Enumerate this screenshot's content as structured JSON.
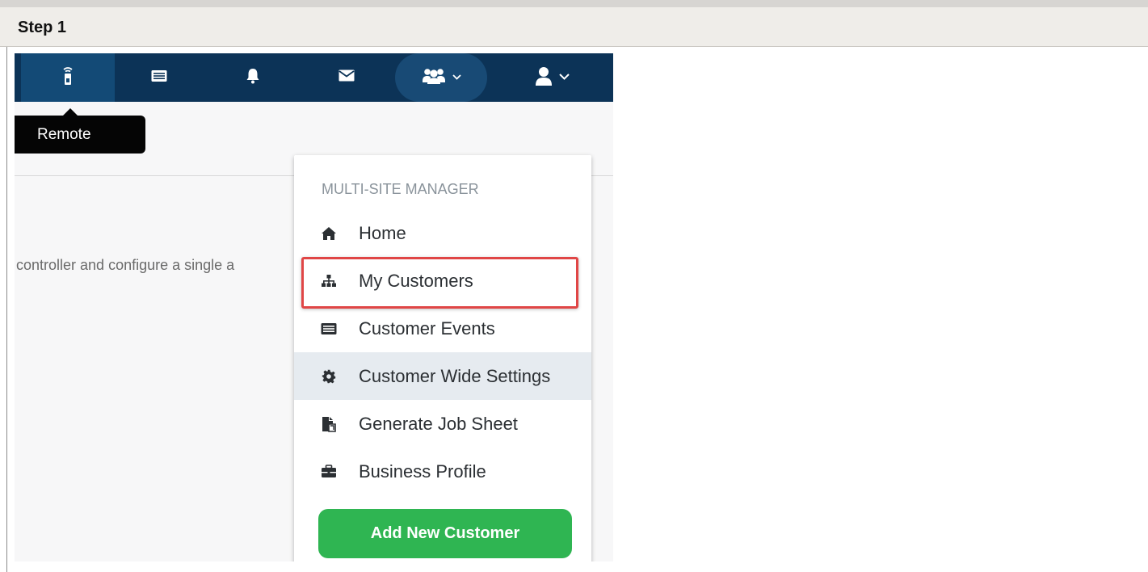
{
  "step": {
    "title": "Step 1"
  },
  "navbar": {
    "items": [
      {
        "name": "remote",
        "icon": "remote-icon"
      },
      {
        "name": "events",
        "icon": "list-icon"
      },
      {
        "name": "alerts",
        "icon": "bell-icon"
      },
      {
        "name": "mail",
        "icon": "envelope-icon"
      },
      {
        "name": "multi-site",
        "icon": "group-icon"
      },
      {
        "name": "user",
        "icon": "user-icon"
      }
    ]
  },
  "tooltip": {
    "label": "Remote"
  },
  "background": {
    "text": "controller and configure a single a"
  },
  "dropdown": {
    "header": "MULTI-SITE MANAGER",
    "items": [
      {
        "label": "Home",
        "icon": "home-icon"
      },
      {
        "label": "My Customers",
        "icon": "sitemap-icon",
        "highlighted": true
      },
      {
        "label": "Customer Events",
        "icon": "list-icon"
      },
      {
        "label": "Customer Wide Settings",
        "icon": "gear-icon",
        "active": true
      },
      {
        "label": "Generate Job Sheet",
        "icon": "file-export-icon"
      },
      {
        "label": "Business Profile",
        "icon": "briefcase-icon"
      }
    ],
    "button_label": "Add New Customer"
  },
  "colors": {
    "navbar": "#0c3357",
    "accent_green": "#2fb552",
    "highlight_red": "#e04646"
  }
}
